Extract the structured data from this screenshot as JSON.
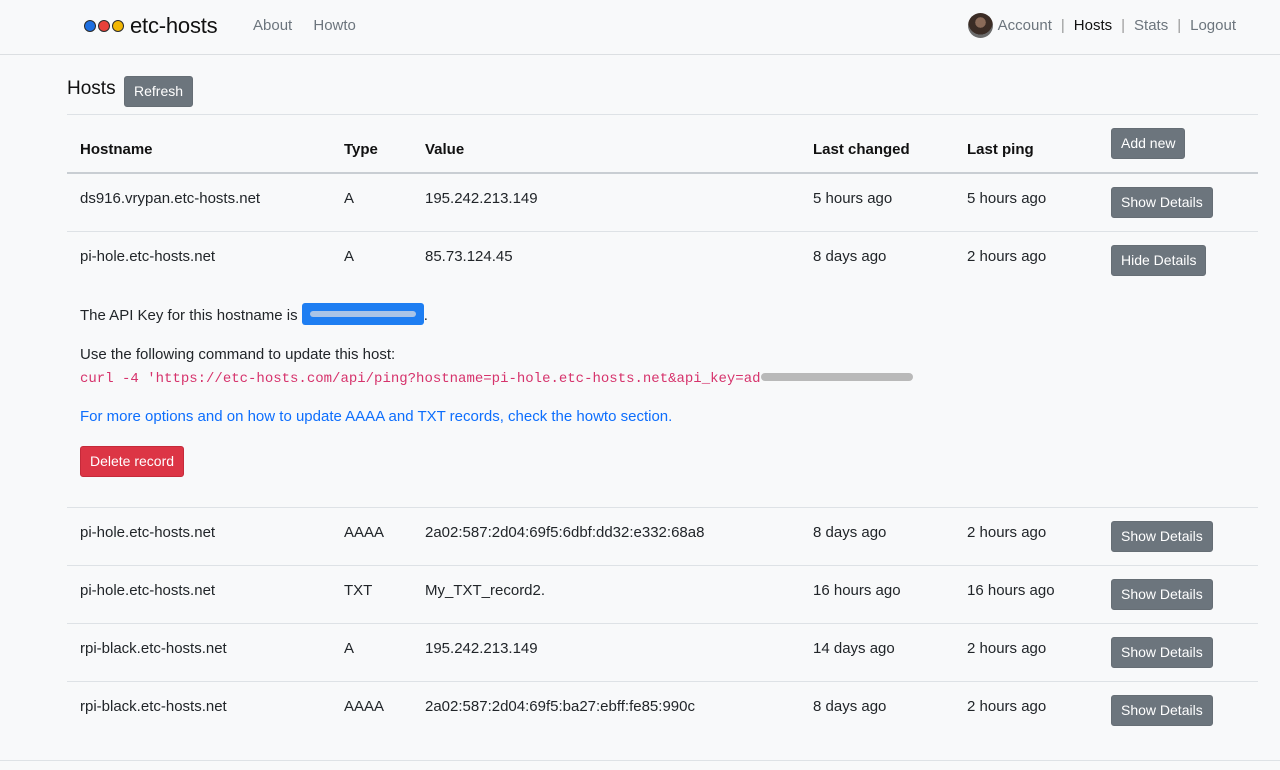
{
  "brand": {
    "name": "etc-hosts",
    "dot_colors": [
      "#1e6fe0",
      "#e8413a",
      "#f2b705"
    ]
  },
  "nav": {
    "left": [
      "About",
      "Howto"
    ],
    "account": "Account",
    "sep": "|",
    "hosts": "Hosts",
    "stats": "Stats",
    "logout": "Logout"
  },
  "page": {
    "title": "Hosts",
    "refresh": "Refresh",
    "add_new": "Add new"
  },
  "table": {
    "headers": [
      "Hostname",
      "Type",
      "Value",
      "Last changed",
      "Last ping"
    ],
    "rows": [
      {
        "hostname": "ds916.vrypan.etc-hosts.net",
        "type": "A",
        "value": "195.242.213.149",
        "changed": "5 hours ago",
        "ping": "5 hours ago",
        "button": "Show Details"
      },
      {
        "hostname": "pi-hole.etc-hosts.net",
        "type": "A",
        "value": "85.73.124.45",
        "changed": "8 days ago",
        "ping": "2 hours ago",
        "button": "Hide Details"
      },
      {
        "hostname": "pi-hole.etc-hosts.net",
        "type": "AAAA",
        "value": "2a02:587:2d04:69f5:6dbf:dd32:e332:68a8",
        "changed": "8 days ago",
        "ping": "2 hours ago",
        "button": "Show Details"
      },
      {
        "hostname": "pi-hole.etc-hosts.net",
        "type": "TXT",
        "value": "My_TXT_record2.",
        "changed": "16 hours ago",
        "ping": "16 hours ago",
        "button": "Show Details"
      },
      {
        "hostname": "rpi-black.etc-hosts.net",
        "type": "A",
        "value": "195.242.213.149",
        "changed": "14 days ago",
        "ping": "2 hours ago",
        "button": "Show Details"
      },
      {
        "hostname": "rpi-black.etc-hosts.net",
        "type": "AAAA",
        "value": "2a02:587:2d04:69f5:ba27:ebff:fe85:990c",
        "changed": "8 days ago",
        "ping": "2 hours ago",
        "button": "Show Details"
      }
    ]
  },
  "details": {
    "api_key_prefix": "The API Key for this hostname is",
    "api_key_suffix": ".",
    "command_intro": "Use the following command to update this host:",
    "command": "curl -4 'https://etc-hosts.com/api/ping?hostname=pi-hole.etc-hosts.net&api_key=ad",
    "howto_link": "For more options and on how to update AAAA and TXT records, check the howto section.",
    "delete": "Delete record"
  }
}
